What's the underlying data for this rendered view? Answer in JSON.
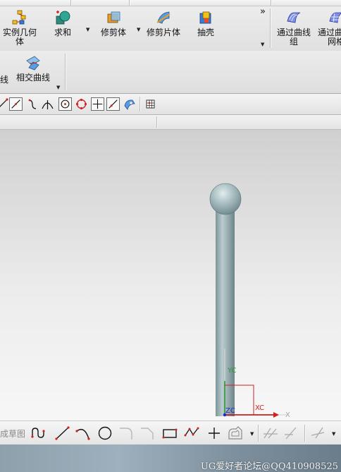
{
  "ribbon": {
    "tools": [
      {
        "label_line1": "实例几何",
        "label_line2": "体",
        "icon": "instance-geometry-icon"
      },
      {
        "label_line1": "求和",
        "icon": "unite-icon"
      },
      {
        "label_line1": "修剪体",
        "icon": "trim-body-icon"
      },
      {
        "label_line1": "修剪片体",
        "icon": "trim-sheet-icon"
      },
      {
        "label_line1": "抽壳",
        "icon": "shell-icon"
      },
      {
        "label_line1": "通过曲线",
        "label_line2": "组",
        "icon": "through-curves-icon"
      },
      {
        "label_line1": "通过曲",
        "label_line2": "网格",
        "icon": "through-curve-mesh-icon"
      }
    ],
    "overflow_glyph": "»",
    "row2": {
      "partial_label": "线",
      "intersection_curve_label": "相交曲线"
    }
  },
  "viewport": {
    "axis_labels": {
      "yc": "YC",
      "xc": "XC",
      "zc": "ZC",
      "x": "X"
    },
    "colors": {
      "yc": "#2f9a2f",
      "xc": "#d22020",
      "zc": "#1a2fc8",
      "model": "#9fb3b7"
    }
  },
  "sketch_bar": {
    "partial_label": "成草图"
  },
  "status": {
    "watermark": "UG爱好者论坛@QQ410908525"
  }
}
